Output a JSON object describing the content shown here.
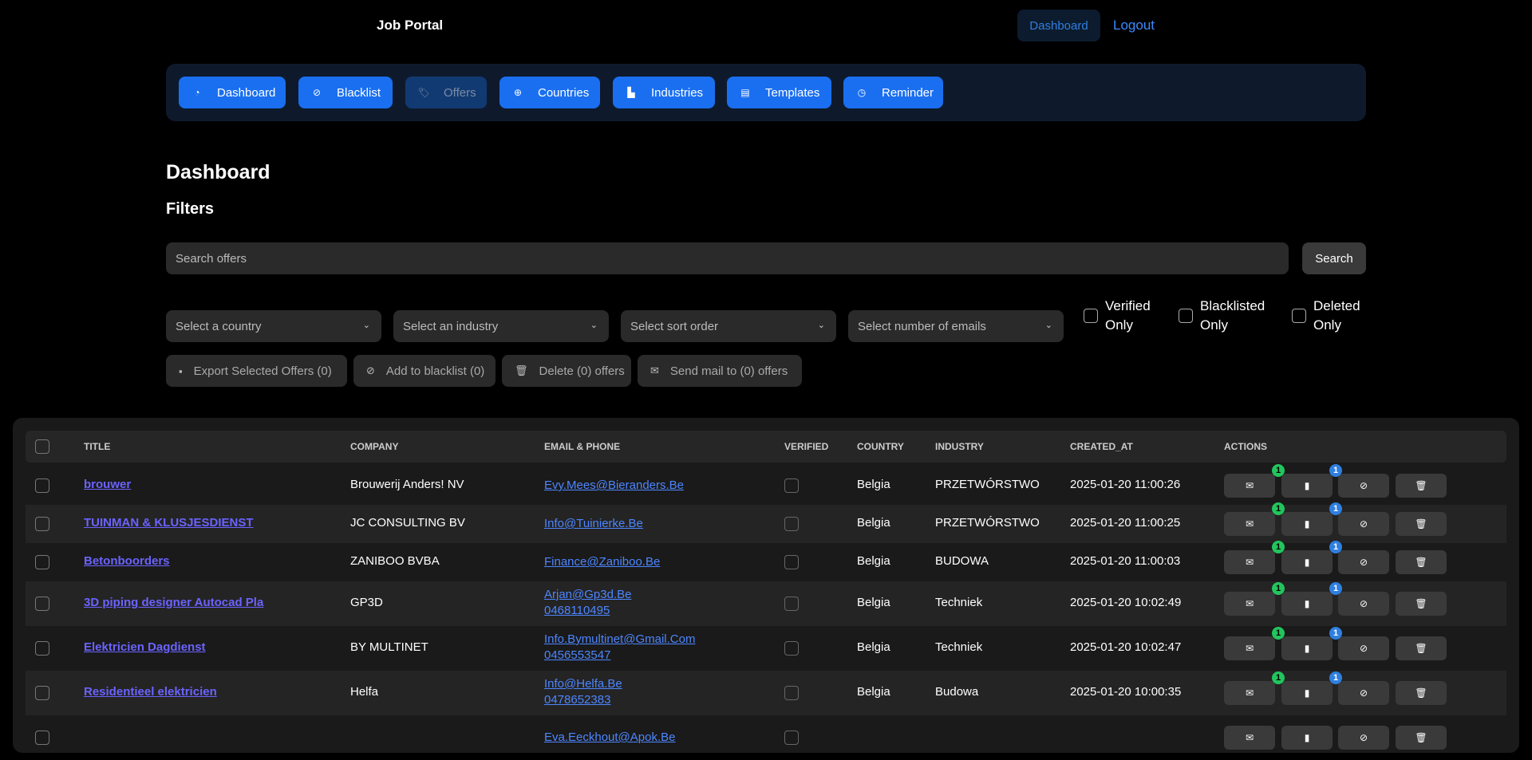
{
  "app": {
    "brand": "Job Portal",
    "top_dashboard": "Dashboard",
    "logout": "Logout"
  },
  "nav": [
    {
      "label": "Dashboard",
      "icon": "gauge-icon"
    },
    {
      "label": "Blacklist",
      "icon": "ban-icon"
    },
    {
      "label": "Offers",
      "icon": "tags-icon"
    },
    {
      "label": "Countries",
      "icon": "globe-icon"
    },
    {
      "label": "Industries",
      "icon": "chart-icon"
    },
    {
      "label": "Templates",
      "icon": "file-icon"
    },
    {
      "label": "Reminder",
      "icon": "clock-icon"
    }
  ],
  "page": {
    "title": "Dashboard",
    "filters_heading": "Filters"
  },
  "search": {
    "placeholder": "Search offers",
    "button": "Search"
  },
  "filters": {
    "country": "Select a country",
    "industry": "Select an industry",
    "sort": "Select sort order",
    "emails": "Select number of emails",
    "verified_1": "Verified",
    "verified_2": "Only",
    "blacklisted_1": "Blacklisted",
    "blacklisted_2": "Only",
    "deleted_1": "Deleted",
    "deleted_2": "Only"
  },
  "bulk_actions": {
    "export": "Export Selected Offers (0)",
    "blacklist": "Add to blacklist (0)",
    "delete": "Delete (0) offers",
    "send": "Send mail to (0) offers"
  },
  "table": {
    "headers": [
      "TITLE",
      "COMPANY",
      "EMAIL & PHONE",
      "VERIFIED",
      "COUNTRY",
      "INDUSTRY",
      "CREATED_AT",
      "ACTIONS"
    ],
    "rows": [
      {
        "title": "brouwer",
        "company": "Brouwerij Anders! NV",
        "email": "Evy.Mees@Bieranders.Be",
        "phone": "",
        "country": "Belgia",
        "industry": "PRZETWÓRSTWO",
        "created": "2025-01-20 11:00:26",
        "mail_count": "1",
        "note_count": "1"
      },
      {
        "title": "TUINMAN & KLUSJESDIENST",
        "company": "JC CONSULTING BV",
        "email": "Info@Tuinierke.Be",
        "phone": "",
        "country": "Belgia",
        "industry": "PRZETWÓRSTWO",
        "created": "2025-01-20 11:00:25",
        "mail_count": "1",
        "note_count": "1"
      },
      {
        "title": "Betonboorders",
        "company": "ZANIBOO BVBA",
        "email": "Finance@Zaniboo.Be",
        "phone": "",
        "country": "Belgia",
        "industry": "BUDOWA",
        "created": "2025-01-20 11:00:03",
        "mail_count": "1",
        "note_count": "1"
      },
      {
        "title": "3D piping designer Autocad Pla",
        "company": "GP3D",
        "email": "Arjan@Gp3d.Be",
        "phone": "0468110495",
        "country": "Belgia",
        "industry": "Techniek",
        "created": "2025-01-20 10:02:49",
        "mail_count": "1",
        "note_count": "1"
      },
      {
        "title": "Elektricien Dagdienst",
        "company": "BY MULTINET",
        "email": "Info.Bymultinet@Gmail.Com",
        "phone": "0456553547",
        "country": "Belgia",
        "industry": "Techniek",
        "created": "2025-01-20 10:02:47",
        "mail_count": "1",
        "note_count": "1"
      },
      {
        "title": "Residentieel elektricien",
        "company": "Helfa",
        "email": "Info@Helfa.Be",
        "phone": "0478652383",
        "country": "Belgia",
        "industry": "Budowa",
        "created": "2025-01-20 10:00:35",
        "mail_count": "1",
        "note_count": "1"
      },
      {
        "title": "",
        "company": "",
        "email": "Eva.Eeckhout@Apok.Be",
        "phone": "",
        "country": "",
        "industry": "",
        "created": "",
        "mail_count": "",
        "note_count": ""
      }
    ]
  },
  "colors": {
    "primary": "#1a6ff0",
    "link": "#6b63ff",
    "email": "#4d86ff",
    "badge_green": "#22c55e",
    "badge_blue": "#2f7fe0"
  }
}
